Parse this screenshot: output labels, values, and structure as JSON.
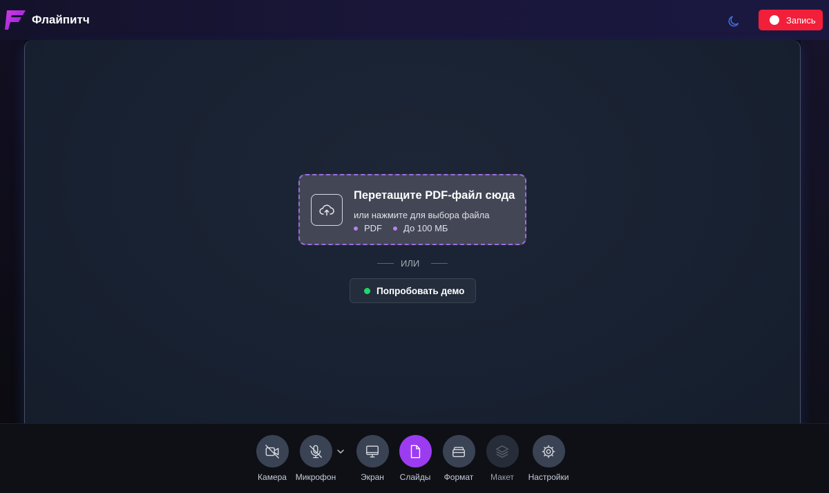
{
  "header": {
    "app_title": "Флайпитч",
    "record_label": "Запись",
    "icons": {
      "logo": "flypitch-logo",
      "theme": "moon-icon",
      "record": "record-dot"
    },
    "colors": {
      "brand": "#a020e0",
      "record": "#f21f3a"
    }
  },
  "dropzone": {
    "title": "Перетащите PDF-файл сюда",
    "subtitle": "или нажмите для выбора файла",
    "format_label": "PDF",
    "size_label": "До 100 МБ",
    "icon": "cloud-upload-icon"
  },
  "divider": {
    "label": "ИЛИ"
  },
  "demo": {
    "label": "Попробовать демо",
    "dot_color": "#1fd96a"
  },
  "toolbar": {
    "items": [
      {
        "label": "Камера",
        "icon": "camera-off-icon",
        "state": "off"
      },
      {
        "label": "Микрофон",
        "icon": "mic-off-icon",
        "state": "off"
      },
      {
        "label": "Экран",
        "icon": "monitor-icon",
        "state": "off"
      },
      {
        "label": "Слайды",
        "icon": "slides-icon",
        "state": "active"
      },
      {
        "label": "Формат",
        "icon": "format-icon",
        "state": "off"
      },
      {
        "label": "Макет",
        "icon": "layers-icon",
        "state": "disabled"
      },
      {
        "label": "Настройки",
        "icon": "settings-icon",
        "state": "off"
      }
    ],
    "active_color": "#9c3cf0"
  }
}
